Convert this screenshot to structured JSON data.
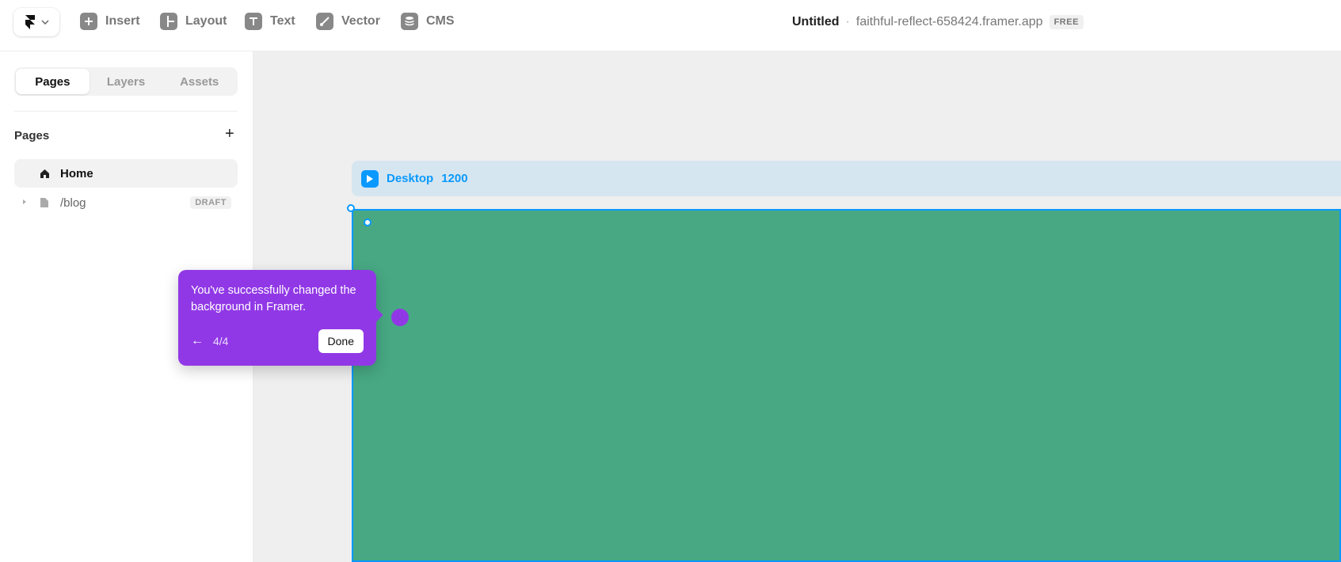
{
  "toolbar": {
    "tools": [
      {
        "label": "Insert",
        "icon": "plus-icon"
      },
      {
        "label": "Layout",
        "icon": "layout-icon"
      },
      {
        "label": "Text",
        "icon": "text-icon"
      },
      {
        "label": "Vector",
        "icon": "vector-icon"
      },
      {
        "label": "CMS",
        "icon": "database-icon"
      }
    ],
    "doc_name": "Untitled",
    "separator": "·",
    "doc_url": "faithful-reflect-658424.framer.app",
    "plan_badge": "FREE"
  },
  "sidebar": {
    "tabs": [
      {
        "label": "Pages",
        "active": true
      },
      {
        "label": "Layers",
        "active": false
      },
      {
        "label": "Assets",
        "active": false
      }
    ],
    "section_title": "Pages",
    "add_label": "+",
    "pages": [
      {
        "label": "Home",
        "icon": "home-icon",
        "selected": true
      },
      {
        "label": "/blog",
        "icon": "page-icon",
        "badge": "DRAFT"
      }
    ]
  },
  "canvas": {
    "frame_name": "Desktop",
    "frame_width": "1200",
    "frame_color": "#47a883",
    "accent": "#0a99ff"
  },
  "tooltip": {
    "message": "You've successfully changed the background in Framer.",
    "back": "←",
    "step": "4/4",
    "done_label": "Done",
    "color": "#9138e6"
  }
}
